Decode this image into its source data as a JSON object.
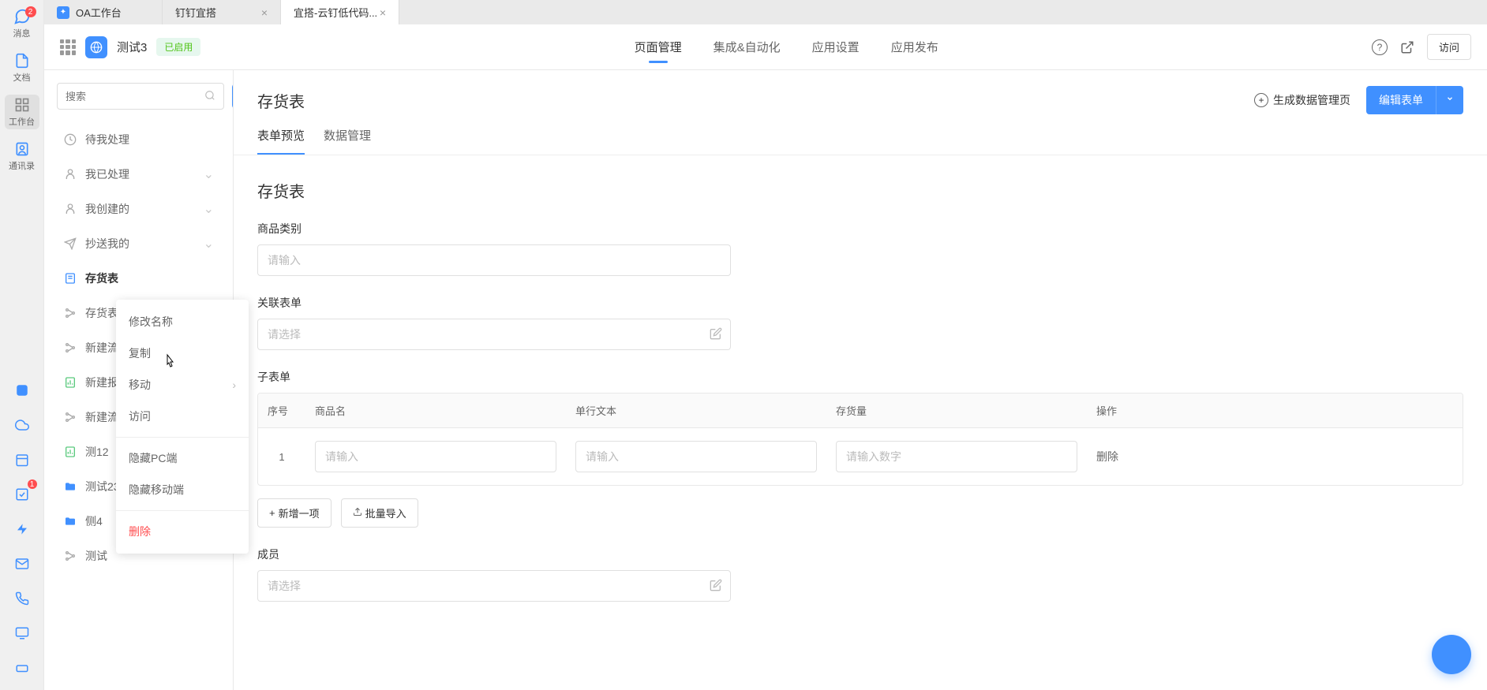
{
  "leftRail": {
    "top": [
      {
        "label": "消息",
        "badge": "2"
      },
      {
        "label": "文档",
        "badge": null
      },
      {
        "label": "工作台",
        "badge": null,
        "active": true
      },
      {
        "label": "通讯录",
        "badge": null
      }
    ]
  },
  "tabs": [
    {
      "label": "OA工作台",
      "hasIcon": true,
      "closable": false,
      "active": false
    },
    {
      "label": "钉钉宜搭",
      "hasIcon": false,
      "closable": true,
      "active": false
    },
    {
      "label": "宜搭-云钉低代码...",
      "hasIcon": false,
      "closable": true,
      "active": true
    }
  ],
  "appHeader": {
    "name": "测试3",
    "status": "已启用",
    "navTabs": [
      "页面管理",
      "集成&自动化",
      "应用设置",
      "应用发布"
    ],
    "activeNavTab": 0,
    "visitBtn": "访问"
  },
  "sidebar": {
    "searchPlaceholder": "搜索",
    "items": [
      {
        "label": "待我处理",
        "icon": "clock"
      },
      {
        "label": "我已处理",
        "icon": "user",
        "eye": true
      },
      {
        "label": "我创建的",
        "icon": "user",
        "eye": true
      },
      {
        "label": "抄送我的",
        "icon": "send",
        "eye": true
      },
      {
        "label": "存货表",
        "icon": "form",
        "active": true
      },
      {
        "label": "存货表",
        "icon": "tree"
      },
      {
        "label": "新建流",
        "icon": "tree"
      },
      {
        "label": "新建报",
        "icon": "report"
      },
      {
        "label": "新建流",
        "icon": "tree"
      },
      {
        "label": "测12",
        "icon": "report"
      },
      {
        "label": "测试23",
        "icon": "folder"
      },
      {
        "label": "侧4",
        "icon": "folder"
      },
      {
        "label": "测试",
        "icon": "tree"
      }
    ]
  },
  "contextMenu": {
    "items": [
      {
        "label": "修改名称"
      },
      {
        "label": "复制"
      },
      {
        "label": "移动",
        "hasChevron": true
      },
      {
        "label": "访问"
      },
      {
        "label": "隐藏PC端",
        "dividerBefore": true
      },
      {
        "label": "隐藏移动端"
      },
      {
        "label": "删除",
        "danger": true,
        "dividerBefore": true
      }
    ]
  },
  "main": {
    "title": "存货表",
    "genBtn": "生成数据管理页",
    "editBtn": "编辑表单",
    "subTabs": [
      "表单预览",
      "数据管理"
    ],
    "activeSubTab": 0,
    "formTitle": "存货表",
    "categoryLabel": "商品类别",
    "categoryPlaceholder": "请输入",
    "relatedFormLabel": "关联表单",
    "relatedFormPlaceholder": "请选择",
    "subformLabel": "子表单",
    "subformCols": {
      "seq": "序号",
      "name": "商品名",
      "text": "单行文本",
      "qty": "存货量",
      "op": "操作"
    },
    "subformRow": {
      "seq": "1",
      "namePlaceholder": "请输入",
      "textPlaceholder": "请输入",
      "qtyPlaceholder": "请输入数字",
      "deleteLabel": "删除"
    },
    "addRowBtn": "新增一项",
    "bulkImportBtn": "批量导入",
    "membersLabel": "成员",
    "membersPlaceholder": "请选择"
  }
}
